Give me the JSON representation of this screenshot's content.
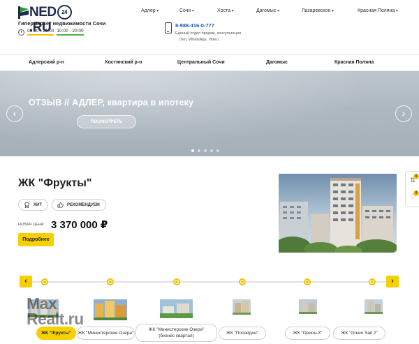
{
  "header": {
    "logo_text_part1": "NED",
    "logo_circle": "24",
    "logo_text_part2": ".RU",
    "tagline": "Гипермаркет недвижимости Сочи",
    "hours": [
      "09:00 - 21:00",
      "10:00 - 20:00"
    ],
    "nav": [
      "Адлер",
      "Сочи",
      "Хоста",
      "Дагомыс",
      "Лазаревское",
      "Красная Поляна"
    ],
    "phone": "8-988-416-0-777",
    "phone_desc_1": "Единый отдел продаж, консультации",
    "phone_desc_2": "(Тел, WhatsApp, Viber)"
  },
  "districts": [
    "Адлерский р-н",
    "Хостинский р-н",
    "Центральный Сочи",
    "Дагомыс",
    "Красная Поляна"
  ],
  "hero": {
    "title": "ОТЗЫВ // АДЛЕР, квартира в ипотеку",
    "button": "ПОСМОТРЕТЬ",
    "prev": "‹",
    "next": "›",
    "slide_count": 5,
    "active_slide": 0
  },
  "featured": {
    "title": "ЖК \"Фрукты\"",
    "badges": [
      "ХИТ",
      "РЕКОМЕНДУЕМ"
    ],
    "price_label": "НОВАЯ ЦЕНА:",
    "price": "3 370 000 ₽",
    "details_button": "Подробнее"
  },
  "side_tools": {
    "compare_count": "0",
    "favorites_count": "0"
  },
  "carousel": {
    "prev": "‹",
    "next": "›",
    "items": [
      {
        "label": "ЖК \"Фрукты\"",
        "active": true
      },
      {
        "label": "ЖК \"Министерские Озера\"",
        "active": false
      },
      {
        "label": "ЖК \"Министерские Озера\" (бизнес квартал)",
        "active": false
      },
      {
        "label": "ЖК \"Посейдон\"",
        "active": false
      },
      {
        "label": "ЖК \"Орион-3\"",
        "active": false
      },
      {
        "label": "ЖК \"Green Sail 2\"",
        "active": false
      }
    ]
  },
  "watermark": {
    "line1": "Max",
    "line2": "Realt.ru"
  },
  "colors": {
    "accent": "#f6d000",
    "brand_navy": "#1d2a4a",
    "link_blue": "#2356b8"
  }
}
